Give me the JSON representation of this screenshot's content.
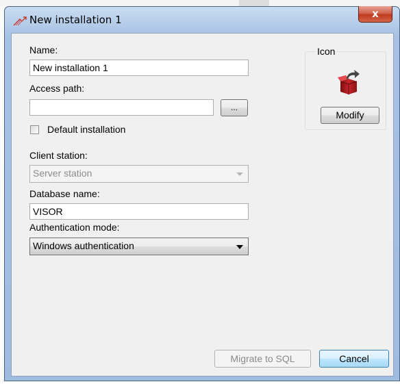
{
  "window": {
    "title": "New installation 1",
    "close_glyph": "x",
    "title_icon": "installation-icon"
  },
  "form": {
    "name_label": "Name:",
    "name_value": "New installation 1",
    "access_path_label": "Access path:",
    "access_path_value": "",
    "browse_label": "...",
    "default_installation_label": "Default installation",
    "default_installation_checked": false,
    "client_station_label": "Client station:",
    "client_station_value": "Server station",
    "database_name_label": "Database name:",
    "database_name_value": "VISOR",
    "auth_mode_label": "Authentication mode:",
    "auth_mode_value": "Windows authentication"
  },
  "icon_group": {
    "title": "Icon",
    "modify_label": "Modify",
    "icon": "box-with-arrow-icon"
  },
  "footer": {
    "migrate_label": "Migrate to SQL",
    "cancel_label": "Cancel"
  },
  "colors": {
    "title_bar": "#a6c1e3",
    "close_button": "#c0391e",
    "client_bg": "#f0f0f0"
  }
}
